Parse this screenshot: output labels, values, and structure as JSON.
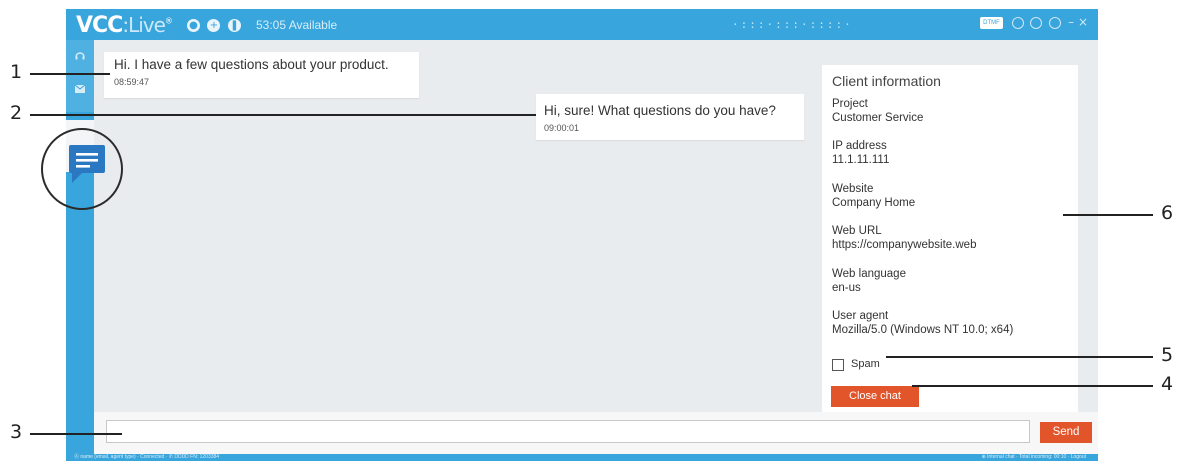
{
  "titlebar": {
    "brand_main": "VCC",
    "brand_sub": "Live",
    "brand_mark": "®",
    "status": "53:05 Available",
    "logo_mark": "·:::·:::·::::·",
    "dtmf_label": "DTMF"
  },
  "sidebar": {
    "items": [
      {
        "icon": "headset-icon"
      },
      {
        "icon": "email-icon"
      },
      {
        "icon": "chat-icon"
      }
    ]
  },
  "chat": {
    "messages": [
      {
        "text": "Hi. I have a few questions about your product.",
        "time": "08:59:47",
        "side": "customer"
      },
      {
        "text": "Hi, sure! What questions do you have?",
        "time": "09:00:01",
        "side": "agent"
      }
    ]
  },
  "client_info": {
    "title": "Client information",
    "fields": [
      {
        "label": "Project",
        "value": "Customer Service"
      },
      {
        "label": "IP address",
        "value": "11.1.11.111"
      },
      {
        "label": "Website",
        "value": "Company Home"
      },
      {
        "label": "Web URL",
        "value": "https://companywebsite.web"
      },
      {
        "label": "Web language",
        "value": "en-us"
      },
      {
        "label": "User agent",
        "value": "Mozilla/5.0 (Windows NT 10.0; x64)"
      }
    ],
    "spam_label": "Spam",
    "spam_checked": false,
    "close_label": "Close chat"
  },
  "composer": {
    "value": "",
    "placeholder": "",
    "send_label": "Send"
  },
  "statusbar": {
    "left": "Ⓐ name (email, agent type) · Connected · ✆ DDDD FN: 1203384",
    "right": "⊕ Internal chat · Total incoming: 00:10 · Logout"
  },
  "callouts": [
    "1",
    "2",
    "3",
    "4",
    "5",
    "6"
  ],
  "colors": {
    "accent": "#38a5dc",
    "action": "#e2542a",
    "chat_icon": "#2a78c2"
  }
}
